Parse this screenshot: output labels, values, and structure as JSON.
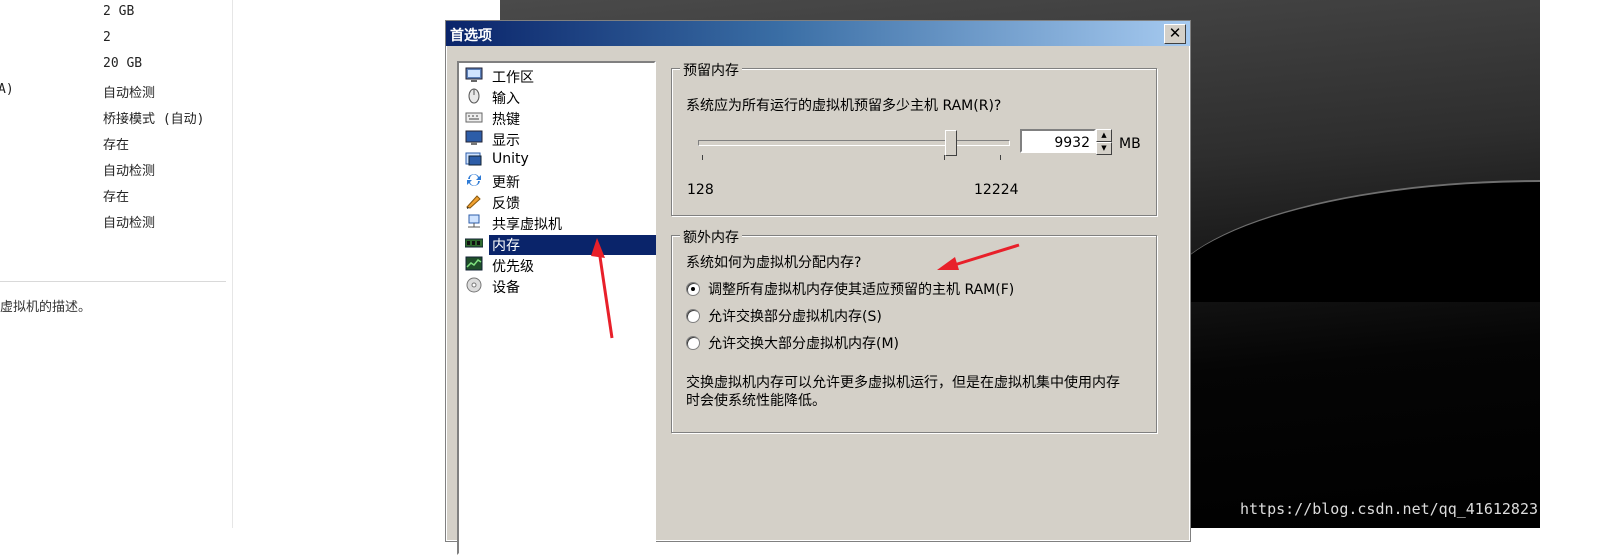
{
  "summary": {
    "rows": [
      {
        "key": "",
        "value": "2 GB"
      },
      {
        "key": "",
        "value": "2"
      },
      {
        "key": "",
        "value": "20 GB"
      },
      {
        "key": "A)",
        "value": "自动检测"
      },
      {
        "key": "",
        "value": "桥接模式 (自动)"
      },
      {
        "key": "",
        "value": "存在"
      },
      {
        "key": "",
        "value": "自动检测"
      },
      {
        "key": "",
        "value": "存在"
      },
      {
        "key": "",
        "value": "自动检测"
      }
    ],
    "description_tail": "虚拟机的描述。"
  },
  "watermark": "https://blog.csdn.net/qq_41612823",
  "dialog": {
    "title": "首选项",
    "close_label": "✕",
    "tree": [
      {
        "label": "工作区",
        "icon": "workspace-icon"
      },
      {
        "label": "输入",
        "icon": "mouse-icon"
      },
      {
        "label": "热键",
        "icon": "keyboard-icon"
      },
      {
        "label": "显示",
        "icon": "monitor-icon"
      },
      {
        "label": "Unity",
        "icon": "unity-icon"
      },
      {
        "label": "更新",
        "icon": "update-icon"
      },
      {
        "label": "反馈",
        "icon": "feedback-icon"
      },
      {
        "label": "共享虚拟机",
        "icon": "shared-vm-icon"
      },
      {
        "label": "内存",
        "icon": "memory-icon",
        "selected": true
      },
      {
        "label": "优先级",
        "icon": "priority-icon"
      },
      {
        "label": "设备",
        "icon": "devices-icon"
      }
    ],
    "reserve": {
      "title": "预留内存",
      "question": "系统应为所有运行的虚拟机预留多少主机 RAM(R)?",
      "min_label": "128",
      "max_label": "12224",
      "value": "9932",
      "unit": "MB",
      "slider_fraction": 0.81
    },
    "extra": {
      "title": "额外内存",
      "question": "系统如何为虚拟机分配内存?",
      "options": [
        {
          "label": "调整所有虚拟机内存使其适应预留的主机 RAM(F)",
          "checked": true
        },
        {
          "label": "允许交换部分虚拟机内存(S)",
          "checked": false
        },
        {
          "label": "允许交换大部分虚拟机内存(M)",
          "checked": false
        }
      ],
      "note_line1": "交换虚拟机内存可以允许更多虚拟机运行，但是在虚拟机集中使用内存",
      "note_line2": "时会使系统性能降低。"
    }
  },
  "colors": {
    "title_bar_start": "#0a246a",
    "selection": "#0a246a",
    "dialog_face": "#d4d0c8",
    "arrow": "#e8202a"
  }
}
